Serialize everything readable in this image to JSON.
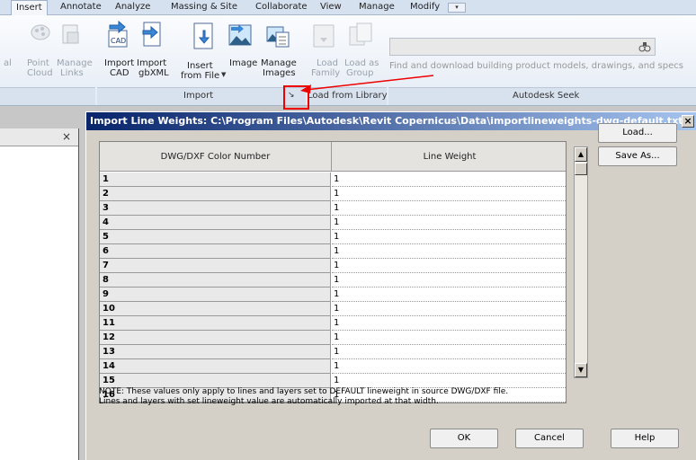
{
  "ribbon_tabs": [
    "Insert",
    "Annotate",
    "Analyze",
    "Massing & Site",
    "Collaborate",
    "View",
    "Manage",
    "Modify"
  ],
  "ribbon_buttons": {
    "partial_left": "al",
    "point_cloud": [
      "Point",
      "Cloud"
    ],
    "manage_links": [
      "Manage",
      "Links"
    ],
    "import_cad": [
      "Import",
      "CAD"
    ],
    "import_gbxml": [
      "Import",
      "gbXML"
    ],
    "insert_from_file": [
      "Insert",
      "from File"
    ],
    "image": "Image",
    "manage_images": [
      "Manage",
      "Images"
    ],
    "load_family": [
      "Load",
      "Family"
    ],
    "load_as_group": [
      "Load as",
      "Group"
    ]
  },
  "panels": {
    "import": "Import",
    "load_from_library": "Load from Library",
    "autodesk_seek": "Autodesk Seek"
  },
  "seek": {
    "placeholder": "Find and download building product models, drawings, and specs"
  },
  "dialog": {
    "title": "Import Line Weights: C:\\Program Files\\Autodesk\\Revit Copernicus\\Data\\importlineweights-dwg-default.txt",
    "columns": [
      "DWG/DXF Color Number",
      "Line Weight"
    ],
    "rows": [
      {
        "color": "1",
        "weight": "1"
      },
      {
        "color": "2",
        "weight": "1"
      },
      {
        "color": "3",
        "weight": "1"
      },
      {
        "color": "4",
        "weight": "1"
      },
      {
        "color": "5",
        "weight": "1"
      },
      {
        "color": "6",
        "weight": "1"
      },
      {
        "color": "7",
        "weight": "1"
      },
      {
        "color": "8",
        "weight": "1"
      },
      {
        "color": "9",
        "weight": "1"
      },
      {
        "color": "10",
        "weight": "1"
      },
      {
        "color": "11",
        "weight": "1"
      },
      {
        "color": "12",
        "weight": "1"
      },
      {
        "color": "13",
        "weight": "1"
      },
      {
        "color": "14",
        "weight": "1"
      },
      {
        "color": "15",
        "weight": "1"
      },
      {
        "color": "16",
        "weight": "1"
      }
    ],
    "note_line1": "NOTE: These values only apply to lines and layers set to DEFAULT lineweight in source DWG/DXF file.",
    "note_line2": "Lines and layers with set lineweight value are automatically imported at that width.",
    "buttons": {
      "load": "Load...",
      "save_as": "Save As...",
      "ok": "OK",
      "cancel": "Cancel",
      "help": "Help"
    }
  },
  "colors": {
    "title_bar": "#08246b",
    "annotation": "#e00000",
    "dialog_bg": "#d4d0c8"
  }
}
